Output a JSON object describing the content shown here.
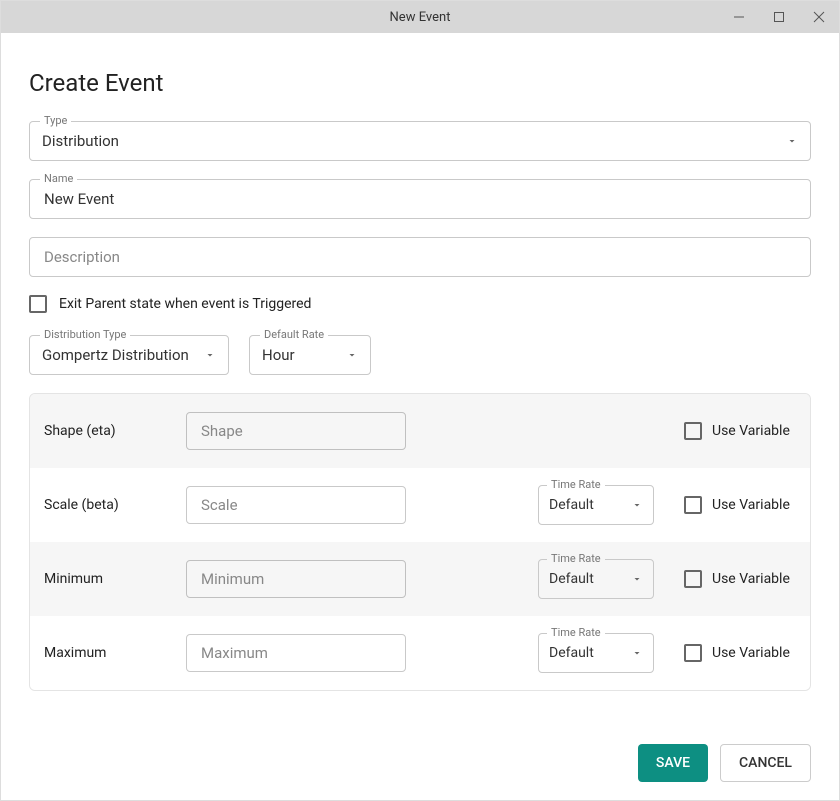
{
  "window": {
    "title": "New Event"
  },
  "page": {
    "heading": "Create Event"
  },
  "fields": {
    "type_label": "Type",
    "type_value": "Distribution",
    "name_label": "Name",
    "name_value": "New Event",
    "description_placeholder": "Description",
    "exit_parent_label": "Exit Parent state when event is Triggered",
    "dist_type_label": "Distribution Type",
    "dist_type_value": "Gompertz Distribution",
    "default_rate_label": "Default Rate",
    "default_rate_value": "Hour"
  },
  "params": {
    "time_rate_label": "Time Rate",
    "time_rate_value": "Default",
    "use_variable_label": "Use Variable",
    "rows": [
      {
        "label": "Shape (eta)",
        "placeholder": "Shape",
        "has_rate": false
      },
      {
        "label": "Scale (beta)",
        "placeholder": "Scale",
        "has_rate": true
      },
      {
        "label": "Minimum",
        "placeholder": "Minimum",
        "has_rate": true
      },
      {
        "label": "Maximum",
        "placeholder": "Maximum",
        "has_rate": true
      }
    ]
  },
  "buttons": {
    "save": "SAVE",
    "cancel": "CANCEL"
  }
}
